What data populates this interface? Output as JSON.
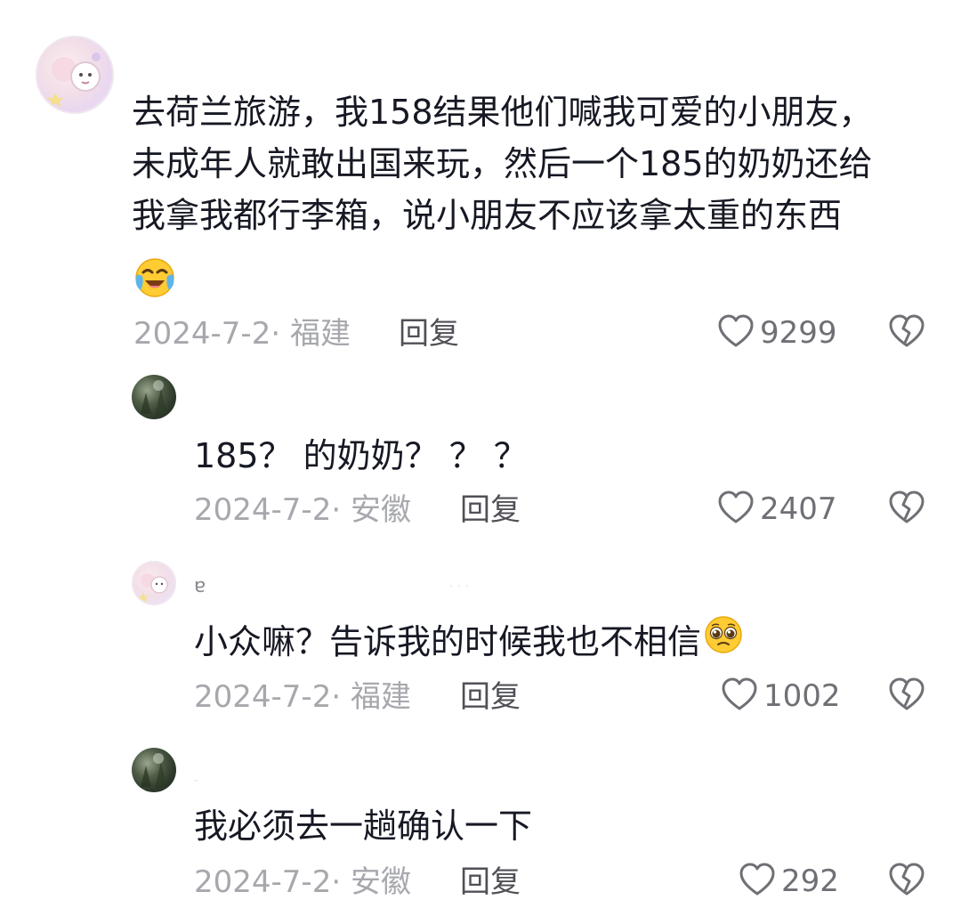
{
  "comments": [
    {
      "username": "",
      "text_lines": [
        "去荷兰旅游，我158结果他们喊我可爱的小朋友，",
        "未成年人就敢出国来玩，然后一个185的奶奶还给",
        "我拿我都行李箱，说小朋友不应该拿太重的东西"
      ],
      "emoji": "crying-laughing-emoji",
      "date": "2024-7-2·",
      "location": "福建",
      "reply_label": "回复",
      "likes": "9299"
    },
    {
      "username": "",
      "text": "185？ 的奶奶？ ？ ？",
      "date": "2024-7-2·",
      "location": "安徽",
      "reply_label": "回复",
      "likes": "2407"
    },
    {
      "username": "ɐ",
      "text": "小众嘛？告诉我的时候我也不相信",
      "emoji": "pleading-face-emoji",
      "date": "2024-7-2·",
      "location": "福建",
      "reply_label": "回复",
      "likes": "1002"
    },
    {
      "username": "-",
      "text": "我必须去一趟确认一下",
      "date": "2024-7-2·",
      "location": "安徽",
      "reply_label": "回复",
      "likes": "292"
    }
  ],
  "colors": {
    "text": "#161823",
    "meta": "#a7a8ad",
    "reply": "#505157",
    "icon": "#6f7075"
  }
}
